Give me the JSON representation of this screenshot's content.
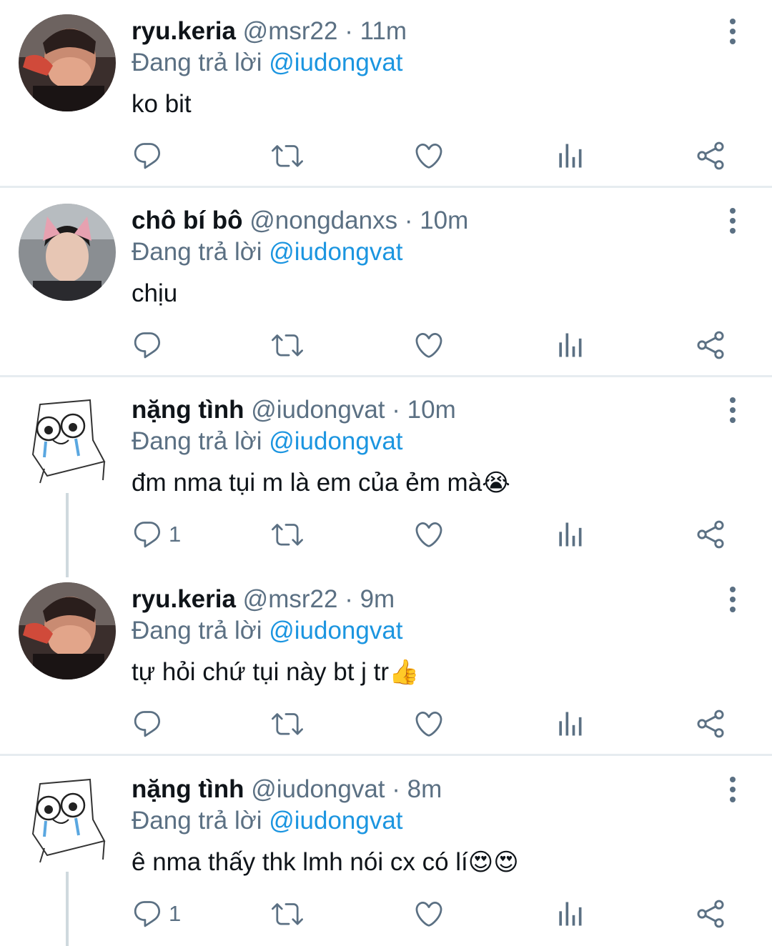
{
  "reply_prefix": "Đang trả lời",
  "colors": {
    "name": "#0f1419",
    "muted": "#5b7083",
    "mention": "#1b95e0",
    "divider": "#e6ecf0"
  },
  "tweets": [
    {
      "name": "ryu.keria",
      "handle": "@msr22",
      "dot": "·",
      "time": "11m",
      "reply_to": "@iudongvat",
      "text": "ko bit",
      "emoji": "",
      "reply_count": "",
      "avatar": "photo-masked-person"
    },
    {
      "name": "chô bí bô",
      "handle": "@nongdanxs",
      "dot": "·",
      "time": "10m",
      "reply_to": "@iudongvat",
      "text": "chịu",
      "emoji": "",
      "reply_count": "",
      "avatar": "photo-cat-ears-filter"
    },
    {
      "name": "nặng tình",
      "handle": "@iudongvat",
      "dot": "·",
      "time": "10m",
      "reply_to": "@iudongvat",
      "text": "đm nma tụi m là em của ẻm mà",
      "emoji": "😭",
      "reply_count": "1",
      "avatar": "drawing-crying-cat-chair"
    },
    {
      "name": "ryu.keria",
      "handle": "@msr22",
      "dot": "·",
      "time": "9m",
      "reply_to": "@iudongvat",
      "text": "tự hỏi chứ tụi này bt j tr",
      "emoji": "👍",
      "reply_count": "",
      "avatar": "photo-masked-person"
    },
    {
      "name": "nặng tình",
      "handle": "@iudongvat",
      "dot": "·",
      "time": "8m",
      "reply_to": "@iudongvat",
      "text": "ê nma thấy thk lmh nói cx có lí",
      "emoji": "😍😍",
      "reply_count": "1",
      "avatar": "drawing-crying-cat-chair"
    }
  ]
}
